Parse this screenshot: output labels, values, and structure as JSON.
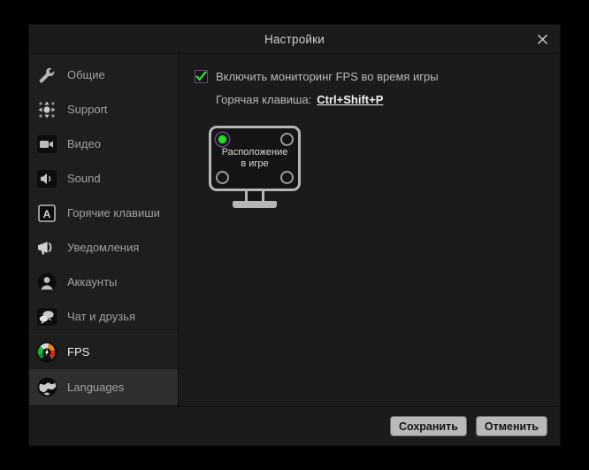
{
  "window": {
    "title": "Настройки",
    "close_icon": "close-icon"
  },
  "sidebar": {
    "items": [
      {
        "label": "Общие",
        "icon": "wrench-icon",
        "state": "normal"
      },
      {
        "label": "Support",
        "icon": "support-dpad-icon",
        "state": "normal"
      },
      {
        "label": "Видео",
        "icon": "video-camera-icon",
        "state": "normal"
      },
      {
        "label": "Sound",
        "icon": "speaker-icon",
        "state": "normal"
      },
      {
        "label": "Горячие клавиши",
        "icon": "keyboard-key-a-icon",
        "state": "normal"
      },
      {
        "label": "Уведомления",
        "icon": "megaphone-icon",
        "state": "normal"
      },
      {
        "label": "Аккаунты",
        "icon": "user-avatar-icon",
        "state": "normal"
      },
      {
        "label": "Чат и друзья",
        "icon": "chat-bubbles-icon",
        "state": "normal"
      },
      {
        "label": "FPS",
        "icon": "fps-gauge-icon",
        "state": "selected"
      },
      {
        "label": "Languages",
        "icon": "globe-icon",
        "state": "hover"
      }
    ]
  },
  "main": {
    "enable_fps_checkbox": {
      "label": "Включить мониторинг FPS во время игры",
      "checked": true,
      "check_color": "#22dd2e",
      "focus_color": "#7a3f92"
    },
    "hotkey": {
      "label": "Горячая клавиша:",
      "value": "Ctrl+Shift+P"
    },
    "overlay_position": {
      "label_line1": "Расположение",
      "label_line2": "в игре",
      "options": [
        {
          "name": "top-left",
          "selected": true
        },
        {
          "name": "top-right",
          "selected": false
        },
        {
          "name": "bottom-left",
          "selected": false
        },
        {
          "name": "bottom-right",
          "selected": false
        }
      ],
      "selected_color": "#22dd2e"
    }
  },
  "footer": {
    "save_label": "Сохранить",
    "cancel_label": "Отменить"
  }
}
